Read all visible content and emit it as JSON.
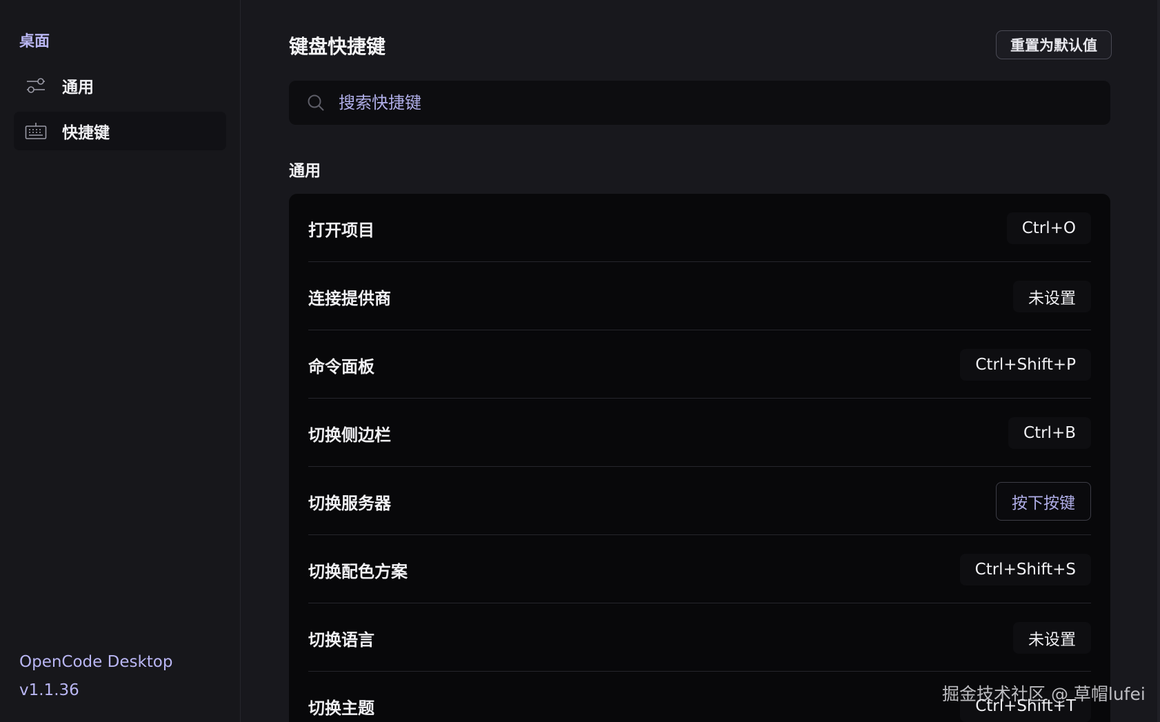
{
  "sidebar": {
    "section_title": "桌面",
    "items": [
      {
        "label": "通用",
        "icon": "sliders-icon",
        "active": false
      },
      {
        "label": "快捷键",
        "icon": "keyboard-icon",
        "active": true
      }
    ],
    "footer": {
      "app_name": "OpenCode Desktop",
      "version": "v1.1.36"
    }
  },
  "main": {
    "title": "键盘快捷键",
    "reset_label": "重置为默认值",
    "search": {
      "placeholder": "搜索快捷键",
      "value": ""
    },
    "group_title": "通用",
    "shortcuts": [
      {
        "label": "打开项目",
        "key": "Ctrl+O"
      },
      {
        "label": "连接提供商",
        "key": "未设置"
      },
      {
        "label": "命令面板",
        "key": "Ctrl+Shift+P"
      },
      {
        "label": "切换侧边栏",
        "key": "Ctrl+B"
      },
      {
        "label": "切换服务器",
        "key": "按下按键"
      },
      {
        "label": "切换配色方案",
        "key": "Ctrl+Shift+S"
      },
      {
        "label": "切换语言",
        "key": "未设置"
      },
      {
        "label": "切换主题",
        "key": "Ctrl+Shift+T"
      }
    ]
  },
  "watermark": "掘金技术社区 @ 草帽lufei",
  "colors": {
    "accent": "#b9b6f3",
    "background": "#18181d",
    "panel": "#08080a"
  }
}
